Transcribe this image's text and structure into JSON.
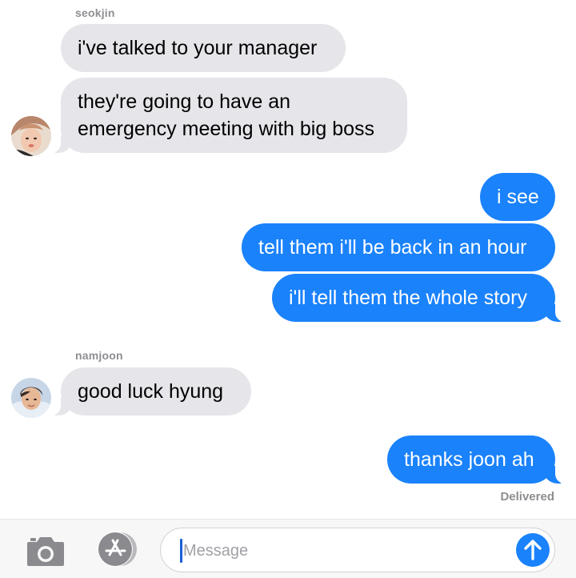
{
  "thread": {
    "group1": {
      "sender": "seokjin",
      "messages": [
        "i've talked to your manager",
        "they're going to have an",
        "emergency meeting with big boss"
      ]
    },
    "outgoing1": [
      "i see",
      "tell them i'll be back in an hour",
      "i'll tell them the whole story"
    ],
    "group2": {
      "sender": "namjoon",
      "messages": [
        "good luck hyung"
      ]
    },
    "outgoing2": [
      "thanks joon ah"
    ],
    "status": "Delivered"
  },
  "input_bar": {
    "placeholder": "Message",
    "icons": {
      "camera": "camera-icon",
      "apps": "app-store-icon",
      "send": "send-arrow-icon"
    }
  },
  "colors": {
    "outgoing_bubble": "#1a82fb",
    "incoming_bubble": "#e5e5ea",
    "meta_text": "#8e8e93"
  }
}
